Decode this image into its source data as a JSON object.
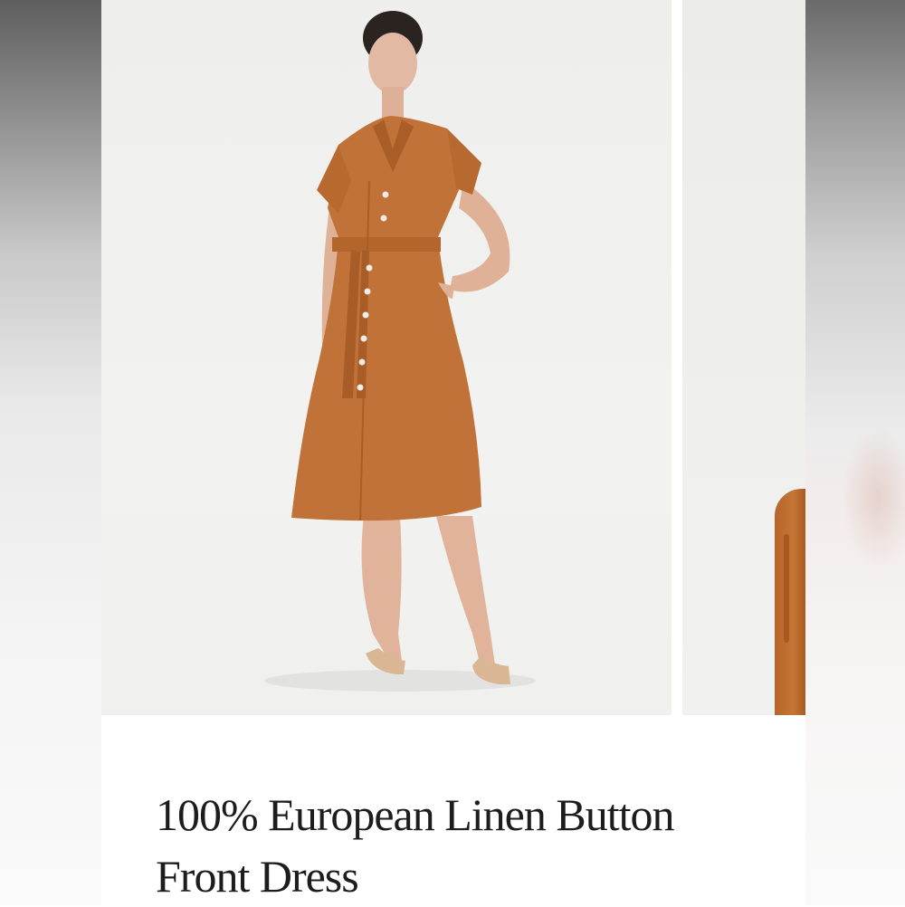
{
  "product": {
    "title": "100% European Linen Button Front Dress"
  },
  "gallery": {
    "main_image_alt": "model wearing dress",
    "next_image_alt": "dress detail"
  },
  "colors": {
    "dress": "#C07238",
    "background": "#F0F0EE"
  }
}
